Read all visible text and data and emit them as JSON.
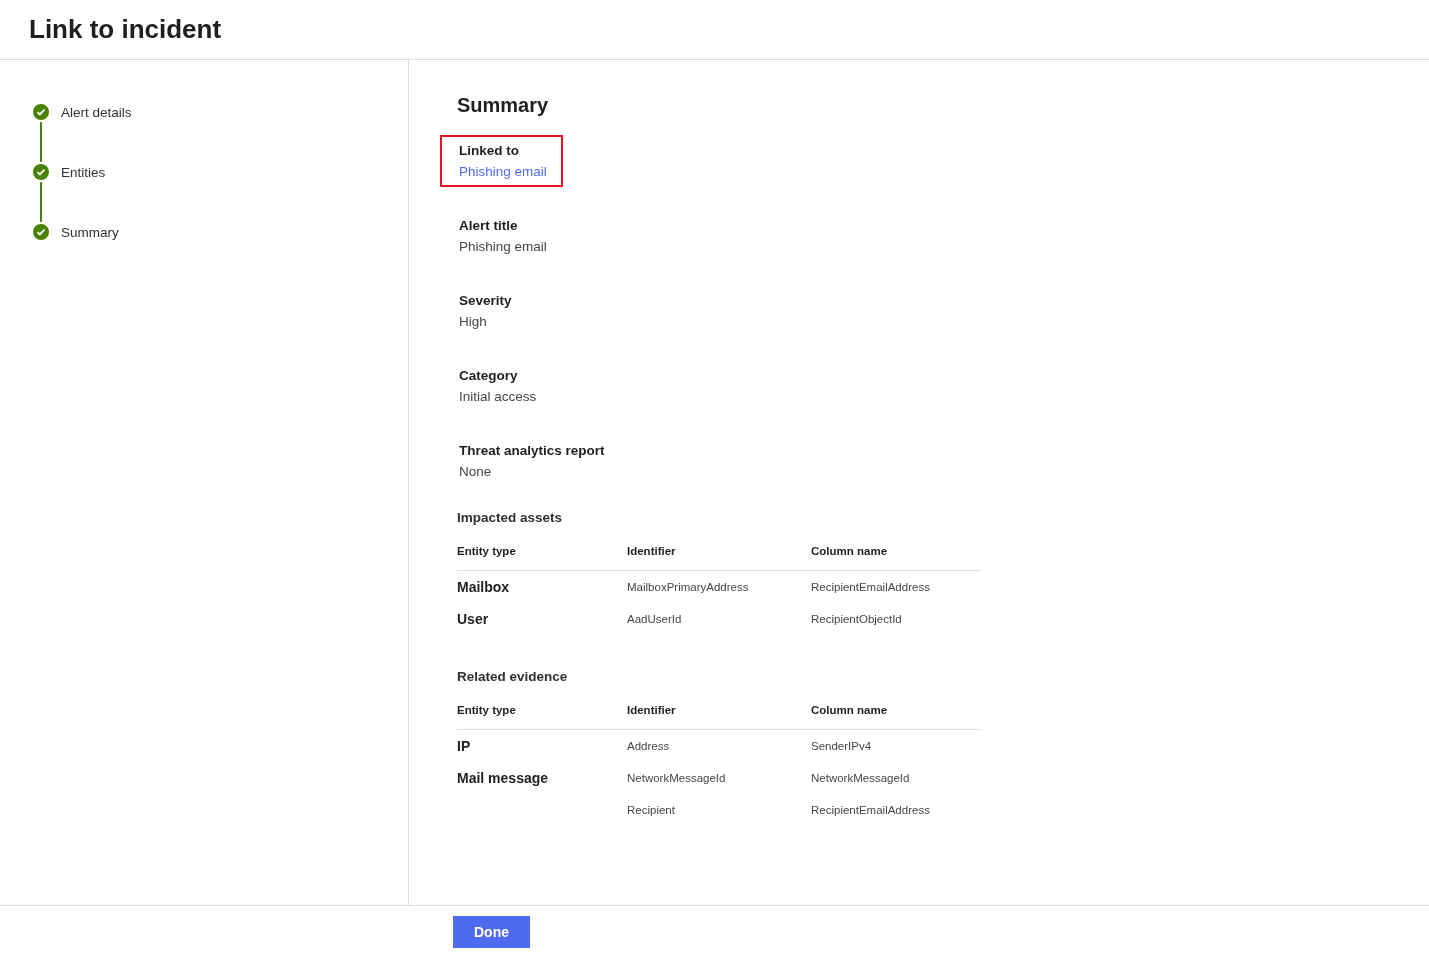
{
  "title": "Link to incident",
  "steps": [
    {
      "label": "Alert details",
      "completed": true
    },
    {
      "label": "Entities",
      "completed": true
    },
    {
      "label": "Summary",
      "completed": true
    }
  ],
  "summary": {
    "heading": "Summary",
    "fields": [
      {
        "label": "Linked to",
        "value": "Phishing email",
        "kind": "link",
        "highlighted": true
      },
      {
        "label": "Alert title",
        "value": "Phishing email",
        "kind": "text",
        "highlighted": false
      },
      {
        "label": "Severity",
        "value": "High",
        "kind": "text",
        "highlighted": false
      },
      {
        "label": "Category",
        "value": "Initial access",
        "kind": "text",
        "highlighted": false
      },
      {
        "label": "Threat analytics report",
        "value": "None",
        "kind": "text",
        "highlighted": false
      }
    ],
    "tables": [
      {
        "title": "Impacted assets",
        "columns": [
          "Entity type",
          "Identifier",
          "Column name"
        ],
        "rows": [
          {
            "entity_type": "Mailbox",
            "identifier": "MailboxPrimaryAddress",
            "column_name": "RecipientEmailAddress"
          },
          {
            "entity_type": "User",
            "identifier": "AadUserId",
            "column_name": "RecipientObjectId"
          }
        ]
      },
      {
        "title": "Related evidence",
        "columns": [
          "Entity type",
          "Identifier",
          "Column name"
        ],
        "rows": [
          {
            "entity_type": "IP",
            "identifier": "Address",
            "column_name": "SenderIPv4"
          },
          {
            "entity_type": "Mail message",
            "identifier": "NetworkMessageId",
            "column_name": "NetworkMessageId"
          },
          {
            "identifier": "Recipient",
            "column_name": "RecipientEmailAddress"
          }
        ]
      }
    ]
  },
  "done_button": "Done"
}
